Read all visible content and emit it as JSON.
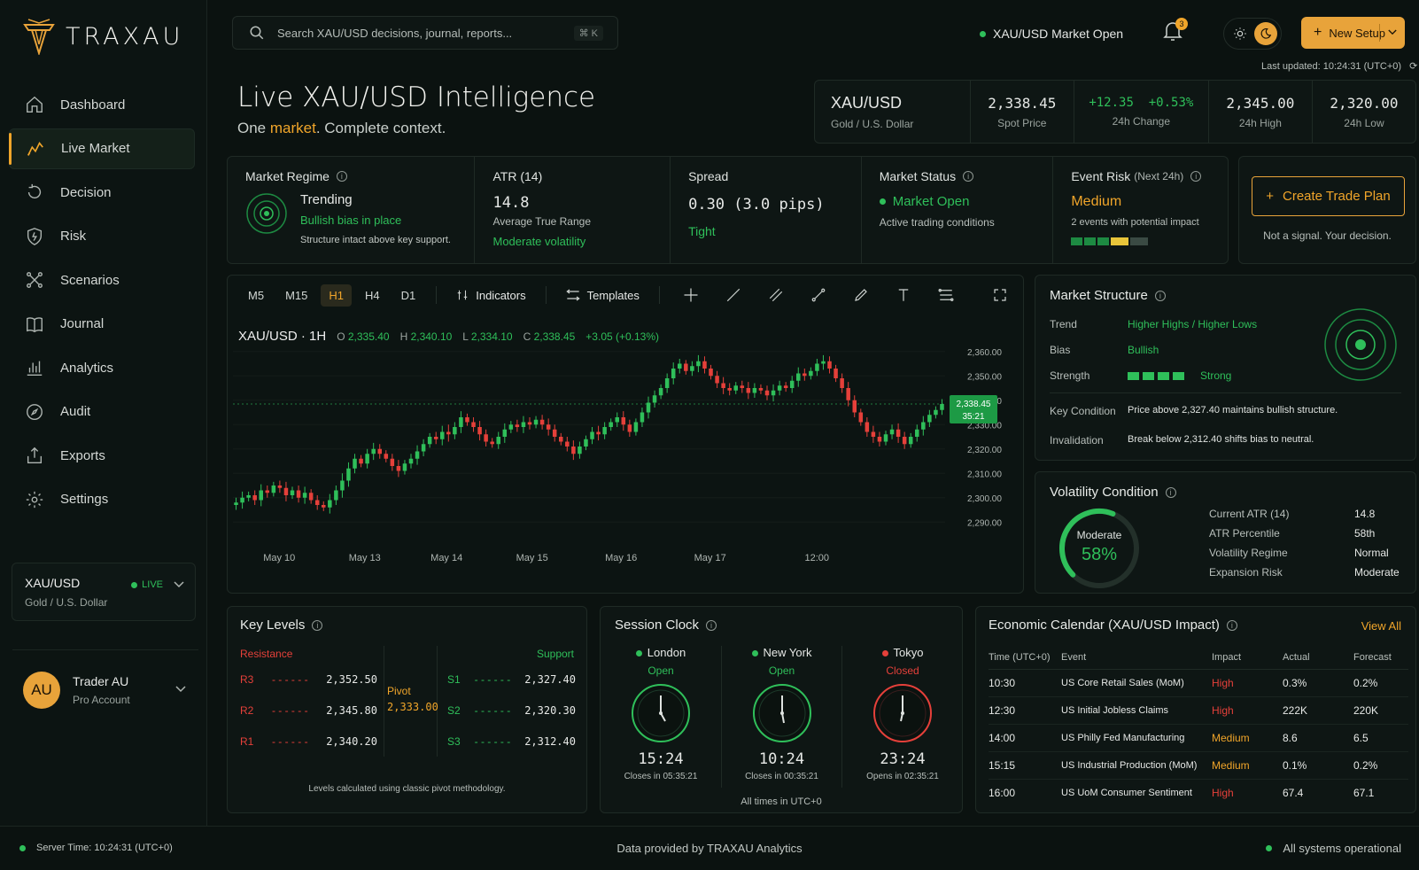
{
  "app": {
    "name": "TRAXAU"
  },
  "sidebar": {
    "items": [
      {
        "label": "Dashboard",
        "icon": "home-icon"
      },
      {
        "label": "Live Market",
        "icon": "chart-line-icon"
      },
      {
        "label": "Decision",
        "icon": "refresh-icon"
      },
      {
        "label": "Risk",
        "icon": "shield-icon"
      },
      {
        "label": "Scenarios",
        "icon": "branch-icon"
      },
      {
        "label": "Journal",
        "icon": "book-icon"
      },
      {
        "label": "Analytics",
        "icon": "bar-chart-icon"
      },
      {
        "label": "Audit",
        "icon": "compass-icon"
      },
      {
        "label": "Exports",
        "icon": "upload-icon"
      },
      {
        "label": "Settings",
        "icon": "gear-icon"
      }
    ],
    "asset": {
      "symbol": "XAU/USD",
      "name": "Gold / U.S. Dollar",
      "status": "LIVE"
    },
    "user": {
      "initials": "AU",
      "name": "Trader AU",
      "role": "Pro Account"
    }
  },
  "topbar": {
    "search_placeholder": "Search XAU/USD decisions, journal, reports...",
    "shortcut": "⌘ K",
    "market_status": "XAU/USD Market Open",
    "notifications": "3",
    "new_setup": "New Setup",
    "last_updated": "Last updated: 10:24:31 (UTC+0)"
  },
  "header": {
    "title": "Live XAU/USD Intelligence",
    "subtitle_a": "One ",
    "subtitle_b": "market",
    "subtitle_c": ". Complete context."
  },
  "quote": {
    "symbol": "XAU/USD",
    "name": "Gold / U.S. Dollar",
    "spot": "2,338.45",
    "spot_label": "Spot Price",
    "change": "+12.35",
    "change_pct": "+0.53%",
    "change_label": "24h Change",
    "high": "2,345.00",
    "high_label": "24h High",
    "low": "2,320.00",
    "low_label": "24h Low"
  },
  "metrics": {
    "regime": {
      "title": "Market Regime",
      "value": "Trending",
      "sub": "Bullish bias in place",
      "note": "Structure intact above key support."
    },
    "atr": {
      "title": "ATR (14)",
      "value": "14.8",
      "sub": "Average True Range",
      "note": "Moderate volatility"
    },
    "spread": {
      "title": "Spread",
      "value": "0.30 (3.0 pips)",
      "sub": "Tight"
    },
    "status": {
      "title": "Market Status",
      "value": "Market Open",
      "sub": "Active trading conditions"
    },
    "event": {
      "title": "Event Risk",
      "title_sub": "(Next 24h)",
      "value": "Medium",
      "sub": "2 events with potential impact"
    },
    "plan": {
      "button": "Create Trade Plan",
      "note": "Not a signal. Your decision."
    }
  },
  "chart_toolbar": {
    "timeframes": [
      "M5",
      "M15",
      "H1",
      "H4",
      "D1"
    ],
    "active": "H1",
    "indicators": "Indicators",
    "templates": "Templates"
  },
  "chart_data": {
    "type": "candlestick",
    "symbol_label": "XAU/USD · 1H",
    "ohlc": {
      "o": "2,335.40",
      "h": "2,340.10",
      "l": "2,334.10",
      "c": "2,338.45",
      "chg": "+3.05 (+0.13%)"
    },
    "ylim": [
      2285,
      2365
    ],
    "y_ticks": [
      "2,360.00",
      "2,350.00",
      "2,340.00",
      "2,330.00",
      "2,320.00",
      "2,310.00",
      "2,300.00",
      "2,290.00"
    ],
    "x_ticks": [
      "May 10",
      "May 13",
      "May 14",
      "May 15",
      "May 16",
      "May 17",
      "12:00"
    ],
    "last_price": "2,338.45",
    "countdown": "35:21",
    "closes": [
      2298,
      2300,
      2301,
      2299,
      2303,
      2302,
      2305,
      2304,
      2301,
      2303,
      2300,
      2302,
      2299,
      2297,
      2296,
      2299,
      2303,
      2307,
      2312,
      2316,
      2314,
      2318,
      2320,
      2318,
      2316,
      2313,
      2311,
      2314,
      2316,
      2319,
      2322,
      2325,
      2324,
      2327,
      2326,
      2329,
      2333,
      2331,
      2329,
      2326,
      2323,
      2322,
      2325,
      2328,
      2330,
      2329,
      2331,
      2330,
      2332,
      2330,
      2328,
      2325,
      2323,
      2321,
      2318,
      2321,
      2324,
      2327,
      2326,
      2329,
      2331,
      2333,
      2330,
      2327,
      2331,
      2335,
      2339,
      2342,
      2345,
      2349,
      2353,
      2355,
      2352,
      2354,
      2356,
      2353,
      2350,
      2347,
      2345,
      2344,
      2346,
      2345,
      2343,
      2345,
      2344,
      2342,
      2344,
      2346,
      2345,
      2348,
      2351,
      2350,
      2352,
      2355,
      2356,
      2353,
      2349,
      2345,
      2340,
      2335,
      2331,
      2327,
      2325,
      2323,
      2326,
      2328,
      2325,
      2322,
      2325,
      2328,
      2331,
      2334,
      2336,
      2338.45
    ],
    "ranges": [
      4,
      5,
      3,
      4,
      5,
      4,
      3,
      4,
      5,
      3,
      4,
      5,
      3,
      4,
      3,
      5,
      4,
      6,
      5,
      4,
      3,
      4,
      5,
      4,
      3,
      4,
      5,
      3,
      4,
      5,
      4,
      3,
      4,
      5,
      6,
      4,
      5,
      3,
      4,
      5,
      4,
      3,
      4,
      5,
      3,
      4,
      5,
      4,
      3,
      4,
      5,
      4,
      3,
      4,
      5,
      4,
      3,
      4,
      5,
      4,
      3,
      4,
      5,
      4,
      3,
      4,
      5,
      4,
      3,
      4,
      5,
      4,
      3,
      4,
      5,
      4,
      3,
      4,
      5,
      4,
      3,
      4,
      5,
      4,
      3,
      4,
      5,
      4,
      3,
      4,
      5,
      4,
      3,
      4,
      5,
      4,
      3,
      4,
      5,
      4,
      3,
      4,
      5,
      4,
      3,
      4,
      5,
      4,
      3,
      4,
      5,
      4,
      3,
      4
    ]
  },
  "structure": {
    "title": "Market Structure",
    "trend_label": "Trend",
    "trend": "Higher Highs / Higher Lows",
    "bias_label": "Bias",
    "bias": "Bullish",
    "strength_label": "Strength",
    "strength": "Strong",
    "key_label": "Key Condition",
    "key": "Price above 2,327.40 maintains bullish structure.",
    "inval_label": "Invalidation",
    "inval": "Break below 2,312.40 shifts bias to neutral."
  },
  "volatility": {
    "title": "Volatility Condition",
    "gauge_label": "Moderate",
    "gauge_value": "58%",
    "percent": 0.58,
    "rows": [
      {
        "k": "Current ATR (14)",
        "v": "14.8"
      },
      {
        "k": "ATR Percentile",
        "v": "58th"
      },
      {
        "k": "Volatility Regime",
        "v": "Normal"
      },
      {
        "k": "Expansion Risk",
        "v": "Moderate"
      }
    ]
  },
  "levels": {
    "title": "Key Levels",
    "resistance_label": "Resistance",
    "support_label": "Support",
    "pivot_label": "Pivot",
    "pivot": "2,333.00",
    "resistance": [
      {
        "k": "R3",
        "v": "2,352.50"
      },
      {
        "k": "R2",
        "v": "2,345.80"
      },
      {
        "k": "R1",
        "v": "2,340.20"
      }
    ],
    "support": [
      {
        "k": "S1",
        "v": "2,327.40"
      },
      {
        "k": "S2",
        "v": "2,320.30"
      },
      {
        "k": "S3",
        "v": "2,312.40"
      }
    ],
    "note": "Levels calculated using classic pivot methodology."
  },
  "sessions": {
    "title": "Session Clock",
    "items": [
      {
        "city": "London",
        "status": "Open",
        "time": "15:24",
        "note": "Closes in 05:35:21"
      },
      {
        "city": "New York",
        "status": "Open",
        "time": "10:24",
        "note": "Closes in 00:35:21"
      },
      {
        "city": "Tokyo",
        "status": "Closed",
        "time": "23:24",
        "note": "Opens in 02:35:21"
      }
    ],
    "footer": "All times in UTC+0"
  },
  "calendar": {
    "title": "Economic Calendar (XAU/USD Impact)",
    "view_all": "View All",
    "headers": [
      "Time (UTC+0)",
      "Event",
      "Impact",
      "Actual",
      "Forecast"
    ],
    "rows": [
      {
        "time": "10:30",
        "event": "US Core Retail Sales (MoM)",
        "impact": "High",
        "actual": "0.3%",
        "forecast": "0.2%"
      },
      {
        "time": "12:30",
        "event": "US Initial Jobless Claims",
        "impact": "High",
        "actual": "222K",
        "forecast": "220K"
      },
      {
        "time": "14:00",
        "event": "US Philly Fed Manufacturing",
        "impact": "Medium",
        "actual": "8.6",
        "forecast": "6.5"
      },
      {
        "time": "15:15",
        "event": "US Industrial Production (MoM)",
        "impact": "Medium",
        "actual": "0.1%",
        "forecast": "0.2%"
      },
      {
        "time": "16:00",
        "event": "US UoM Consumer Sentiment",
        "impact": "High",
        "actual": "67.4",
        "forecast": "67.1"
      }
    ]
  },
  "footer": {
    "server_time": "Server Time: 10:24:31 (UTC+0)",
    "provider": "Data provided by TRAXAU Analytics",
    "systems": "All systems operational"
  },
  "colors": {
    "accent": "#f0a52a",
    "up": "#2fbf5a",
    "down": "#e5403a",
    "bg": "#0b1210"
  }
}
